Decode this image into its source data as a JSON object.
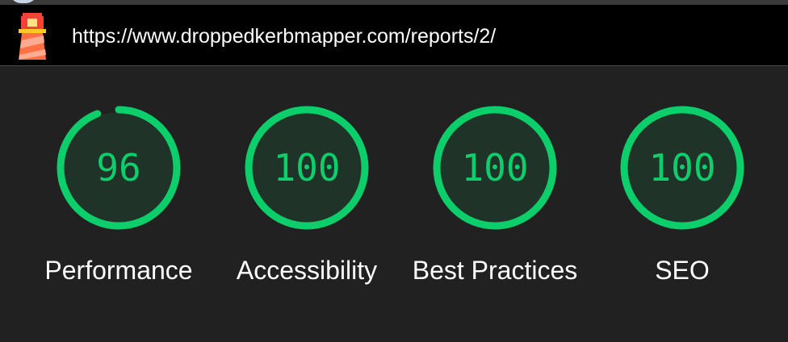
{
  "address_bar": {
    "url": "https://www.droppedkerbmapper.com/reports/2/",
    "logo_icon": "lighthouse-icon"
  },
  "scores": [
    {
      "label": "Performance",
      "value": "96",
      "score_fraction": 0.96,
      "color": "#0cce6b"
    },
    {
      "label": "Accessibility",
      "value": "100",
      "score_fraction": 1.0,
      "color": "#0cce6b"
    },
    {
      "label": "Best Practices",
      "value": "100",
      "score_fraction": 1.0,
      "color": "#0cce6b"
    },
    {
      "label": "SEO",
      "value": "100",
      "score_fraction": 1.0,
      "color": "#0cce6b"
    }
  ],
  "colors": {
    "pass": "#0cce6b",
    "gauge_fill": "#1f3328",
    "background": "#212121",
    "url_bar": "#000000"
  }
}
